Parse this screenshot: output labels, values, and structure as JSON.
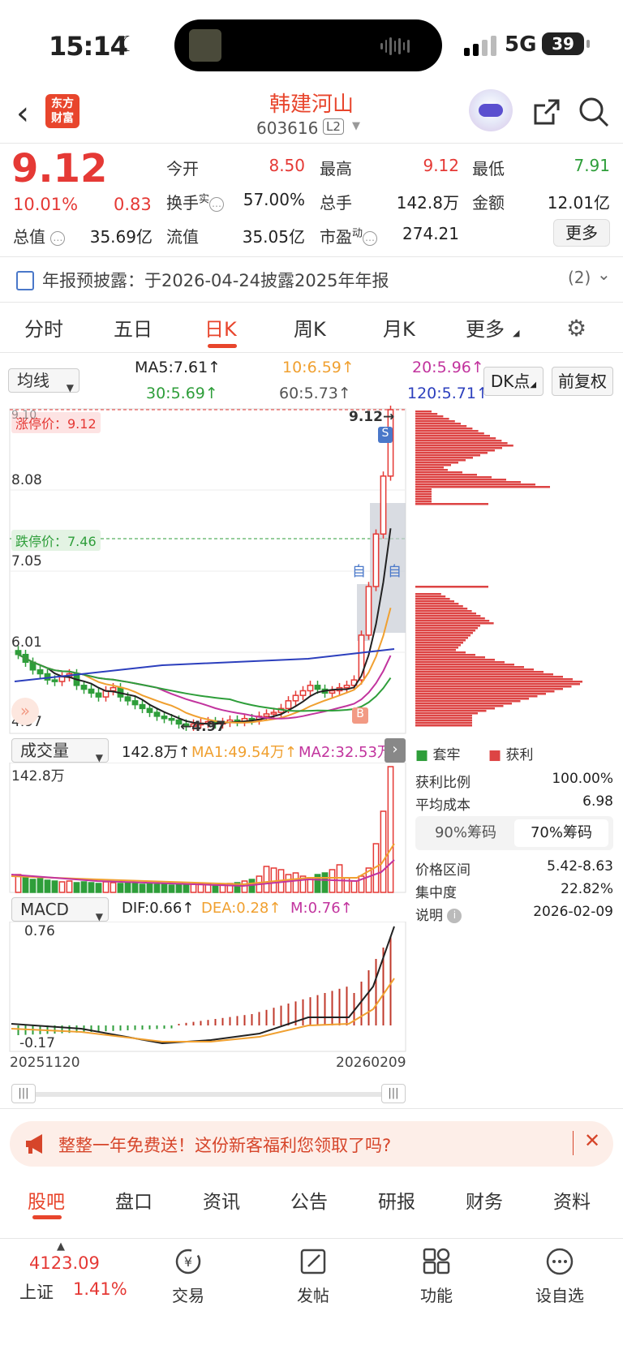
{
  "status": {
    "time": "15:14",
    "network": "5G",
    "battery": "39"
  },
  "header": {
    "logo_text": "东方财富",
    "stock_name": "韩建河山",
    "stock_code": "603616",
    "level_badge": "L2"
  },
  "quote": {
    "price": "9.12",
    "change_pct": "10.01%",
    "change_amt": "0.83",
    "open_label": "今开",
    "open": "8.50",
    "high_label": "最高",
    "high": "9.12",
    "low_label": "最低",
    "low": "7.91",
    "turnover_label": "换手",
    "turnover_sup": "实",
    "turnover": "57.00%",
    "volume_label": "总手",
    "volume": "142.8万",
    "amount_label": "金额",
    "amount": "12.01亿",
    "mcap_label": "总值",
    "mcap": "35.69亿",
    "float_label": "流值",
    "float": "35.05亿",
    "pe_label": "市盈",
    "pe_sup": "动",
    "pe": "274.21",
    "more_label": "更多"
  },
  "notice": {
    "text": "年报预披露：于2026-04-24披露2025年年报",
    "count": "(2)"
  },
  "ktabs": {
    "items": [
      "分时",
      "五日",
      "日K",
      "周K",
      "月K",
      "更多"
    ],
    "active": "日K"
  },
  "ma_bar": {
    "select_label": "均线",
    "ma5": "MA5:7.61↑",
    "ma10": "10:6.59↑",
    "ma20": "20:5.96↑",
    "ma30": "30:5.69↑",
    "ma60": "60:5.73↑",
    "ma120": "120:5.71↑",
    "dk_label": "DK点",
    "fq_label": "前复权",
    "colors": {
      "ma5": "#222222",
      "ma10": "#f0a030",
      "ma20": "#c2349e",
      "ma30": "#2e9e3a",
      "ma60": "#555555",
      "ma120": "#2c3fbd"
    }
  },
  "kchart_labels": {
    "limit_up": "涨停价：9.12",
    "limit_down": "跌停价：7.46",
    "y_top": "9.10",
    "y1": "8.08",
    "y2": "7.05",
    "y3": "6.01",
    "y_bottom": "4.97",
    "high_mark": "9.12",
    "low_mark": "4.97",
    "marker_s": "S",
    "marker_b": "B",
    "marker_zi": "自"
  },
  "volume_bar": {
    "select_label": "成交量",
    "value": "142.8万↑",
    "ma1": "MA1:49.54万↑",
    "ma2": "MA2:32.53万",
    "y_top": "142.8万"
  },
  "macd_bar": {
    "select_label": "MACD",
    "dif": "DIF:0.66↑",
    "dea": "DEA:0.28↑",
    "m": "M:0.76↑",
    "y_top": "0.76",
    "y_bottom": "-0.17"
  },
  "dates": {
    "start": "20251120",
    "end": "20260209"
  },
  "chips": {
    "legend_trapped": "套牢",
    "legend_profit": "获利",
    "profit_ratio_label": "获利比例",
    "profit_ratio": "100.00%",
    "avg_cost_label": "平均成本",
    "avg_cost": "6.98",
    "tab_90": "90%筹码",
    "tab_70": "70%筹码",
    "range_label": "价格区间",
    "range": "5.42-8.63",
    "concentration_label": "集中度",
    "concentration": "22.82%",
    "note_label": "说明",
    "note_date": "2026-02-09"
  },
  "promo": {
    "text": "整整一年免费送！这份新客福利您领取了吗?"
  },
  "btabs": {
    "items": [
      "股吧",
      "盘口",
      "资讯",
      "公告",
      "研报",
      "财务",
      "资料"
    ],
    "active": "股吧"
  },
  "footer": {
    "index_value": "4123.09",
    "index_name": "上证",
    "index_pct": "1.41%",
    "items": [
      "交易",
      "发帖",
      "功能",
      "设自选"
    ]
  }
}
